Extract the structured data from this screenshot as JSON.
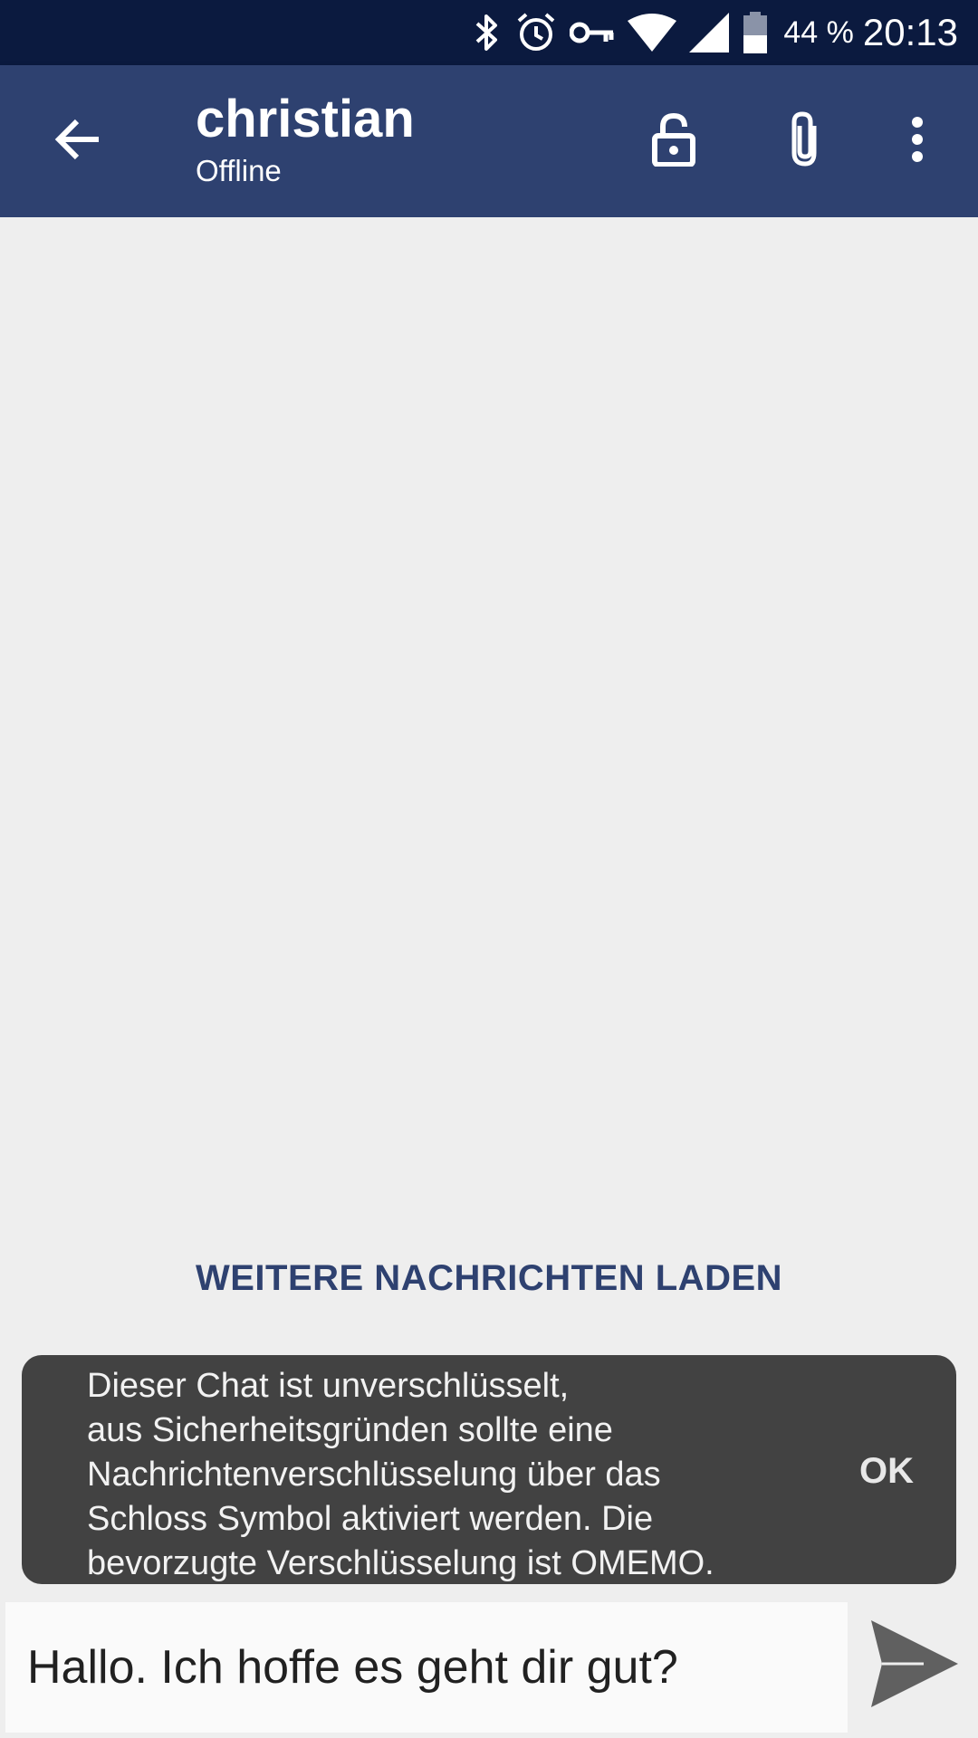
{
  "status_bar": {
    "icons": [
      "bluetooth-icon",
      "alarm-icon",
      "vpn-key-icon",
      "wifi-icon",
      "cell-signal-icon",
      "battery-icon"
    ],
    "battery_percent": "44 %",
    "time": "20:13"
  },
  "toolbar": {
    "title": "christian",
    "subtitle": "Offline",
    "icons": [
      "back-arrow-icon",
      "lock-open-icon",
      "paperclip-icon",
      "more-vert-icon"
    ],
    "color": "#2e4170"
  },
  "messages": {
    "load_more_label": "WEITERE NACHRICHTEN LADEN"
  },
  "snackbar": {
    "message": "Dieser Chat ist unverschlüsselt,\naus Sicherheitsgründen sollte eine\nNachrichtenverschlüsselung über das\nSchloss Symbol aktiviert werden. Die\nbevorzugte Verschlüsselung ist OMEMO.",
    "action_label": "OK"
  },
  "composer": {
    "value": "Hallo. Ich hoffe es geht dir gut?",
    "send_icon": "send-icon"
  }
}
